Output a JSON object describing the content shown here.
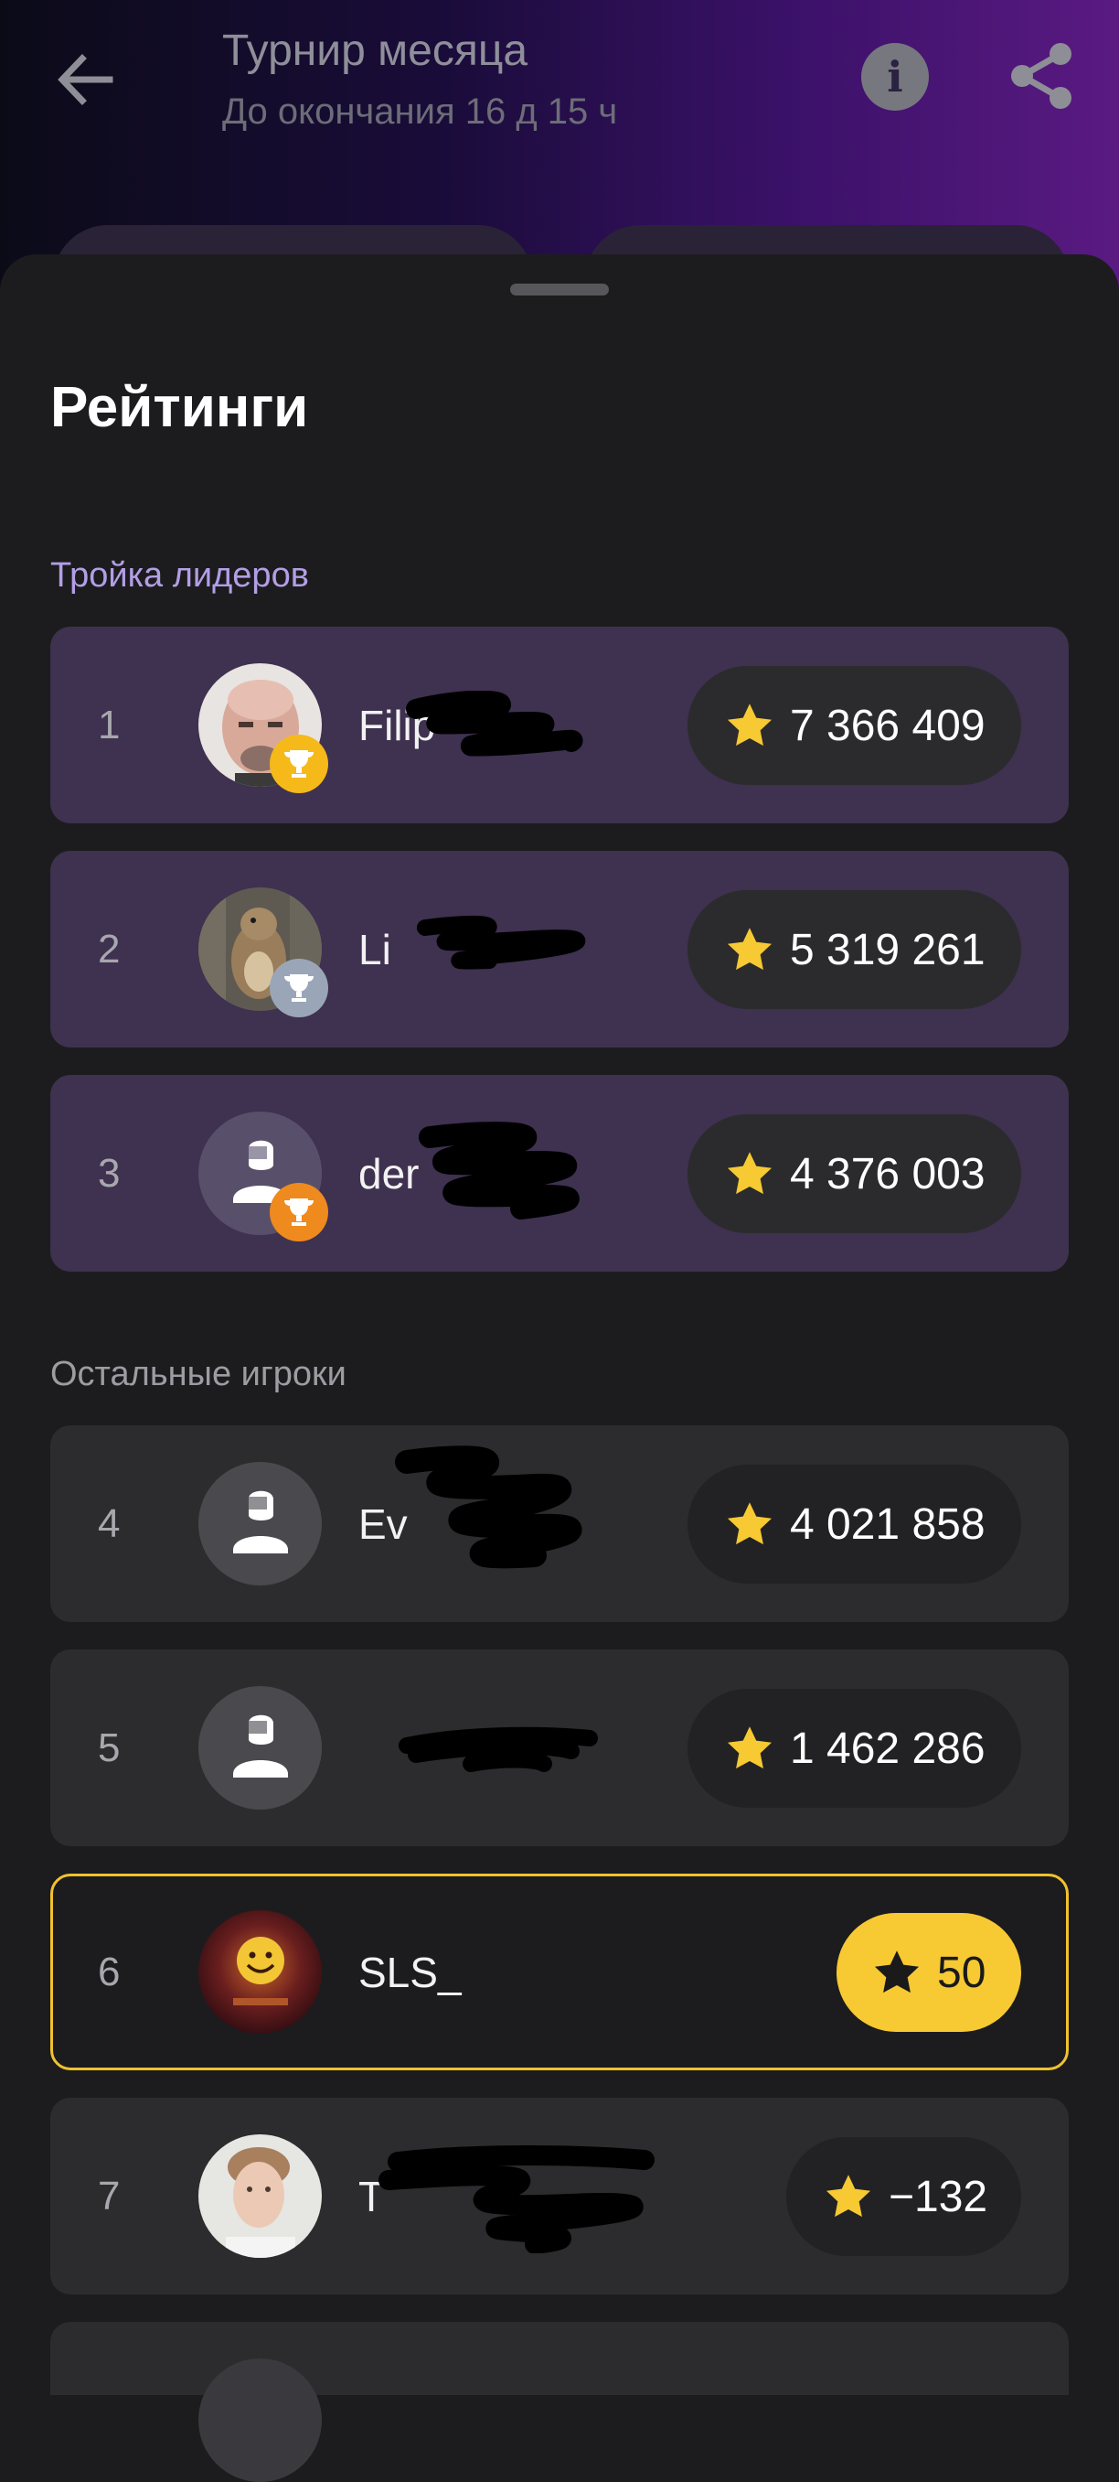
{
  "header": {
    "title": "Турнир месяца",
    "subtitle": "До окончания 16 д 15 ч",
    "back_icon": "arrow-left-icon",
    "info_icon": "info-icon",
    "info_glyph": "i",
    "share_icon": "share-icon"
  },
  "sheet": {
    "title": "Рейтинги",
    "top_section_label": "Тройка лидеров",
    "rest_section_label": "Остальные игроки"
  },
  "players": [
    {
      "rank": "1",
      "name": "Filip",
      "score": "7 366 409",
      "trophy": "gold",
      "avatar": "photo-bald-man"
    },
    {
      "rank": "2",
      "name": "Li",
      "score": "5 319 261",
      "trophy": "silver",
      "avatar": "photo-squirrel"
    },
    {
      "rank": "3",
      "name": "der",
      "score": "4 376 003",
      "trophy": "bronze",
      "avatar": "default-user"
    },
    {
      "rank": "4",
      "name": "Ev",
      "score": "4 021 858",
      "avatar": "default-user"
    },
    {
      "rank": "5",
      "name": "",
      "score": "1 462 286",
      "avatar": "default-user"
    },
    {
      "rank": "6",
      "name": "SLS_",
      "score": "50",
      "current_user": true,
      "avatar": "photo-smiley"
    },
    {
      "rank": "7",
      "name": "T",
      "score": "−132",
      "avatar": "photo-young-man"
    }
  ],
  "colors": {
    "accent_yellow": "#f7c933",
    "leader_row": "#3f3150",
    "normal_row": "#2c2c2e",
    "section_purple": "#b39ee6"
  }
}
